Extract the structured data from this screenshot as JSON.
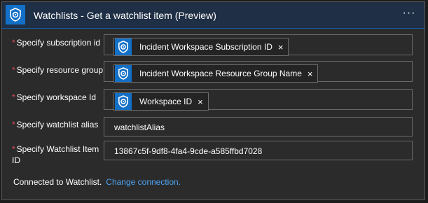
{
  "header": {
    "title": "Watchlists - Get a watchlist item (Preview)",
    "icon": "sentinel-shield-icon",
    "more_label": "···"
  },
  "fields": {
    "subscription": {
      "required_mark": "*",
      "label": "Specify subscription id",
      "token": "Incident Workspace Subscription ID",
      "remove": "×"
    },
    "resource_group": {
      "required_mark": "*",
      "label": "Specify resource group",
      "token": "Incident Workspace Resource Group Name",
      "remove": "×"
    },
    "workspace": {
      "required_mark": "*",
      "label": "Specify workspace Id",
      "token": "Workspace ID",
      "remove": "×"
    },
    "alias": {
      "required_mark": "*",
      "label": "Specify watchlist alias",
      "value": "watchlistAlias"
    },
    "item_id": {
      "required_mark": "*",
      "label": "Specify Watchlist Item ID",
      "value": "13867c5f-9df8-4fa4-9cde-a585ffbd7028"
    }
  },
  "footer": {
    "connected_text": "Connected to Watchlist.",
    "change_link": "Change connection."
  },
  "colors": {
    "accent": "#1370c7",
    "header_bg": "#1f2f45",
    "required": "#e74a57",
    "link": "#4ea3f2"
  }
}
